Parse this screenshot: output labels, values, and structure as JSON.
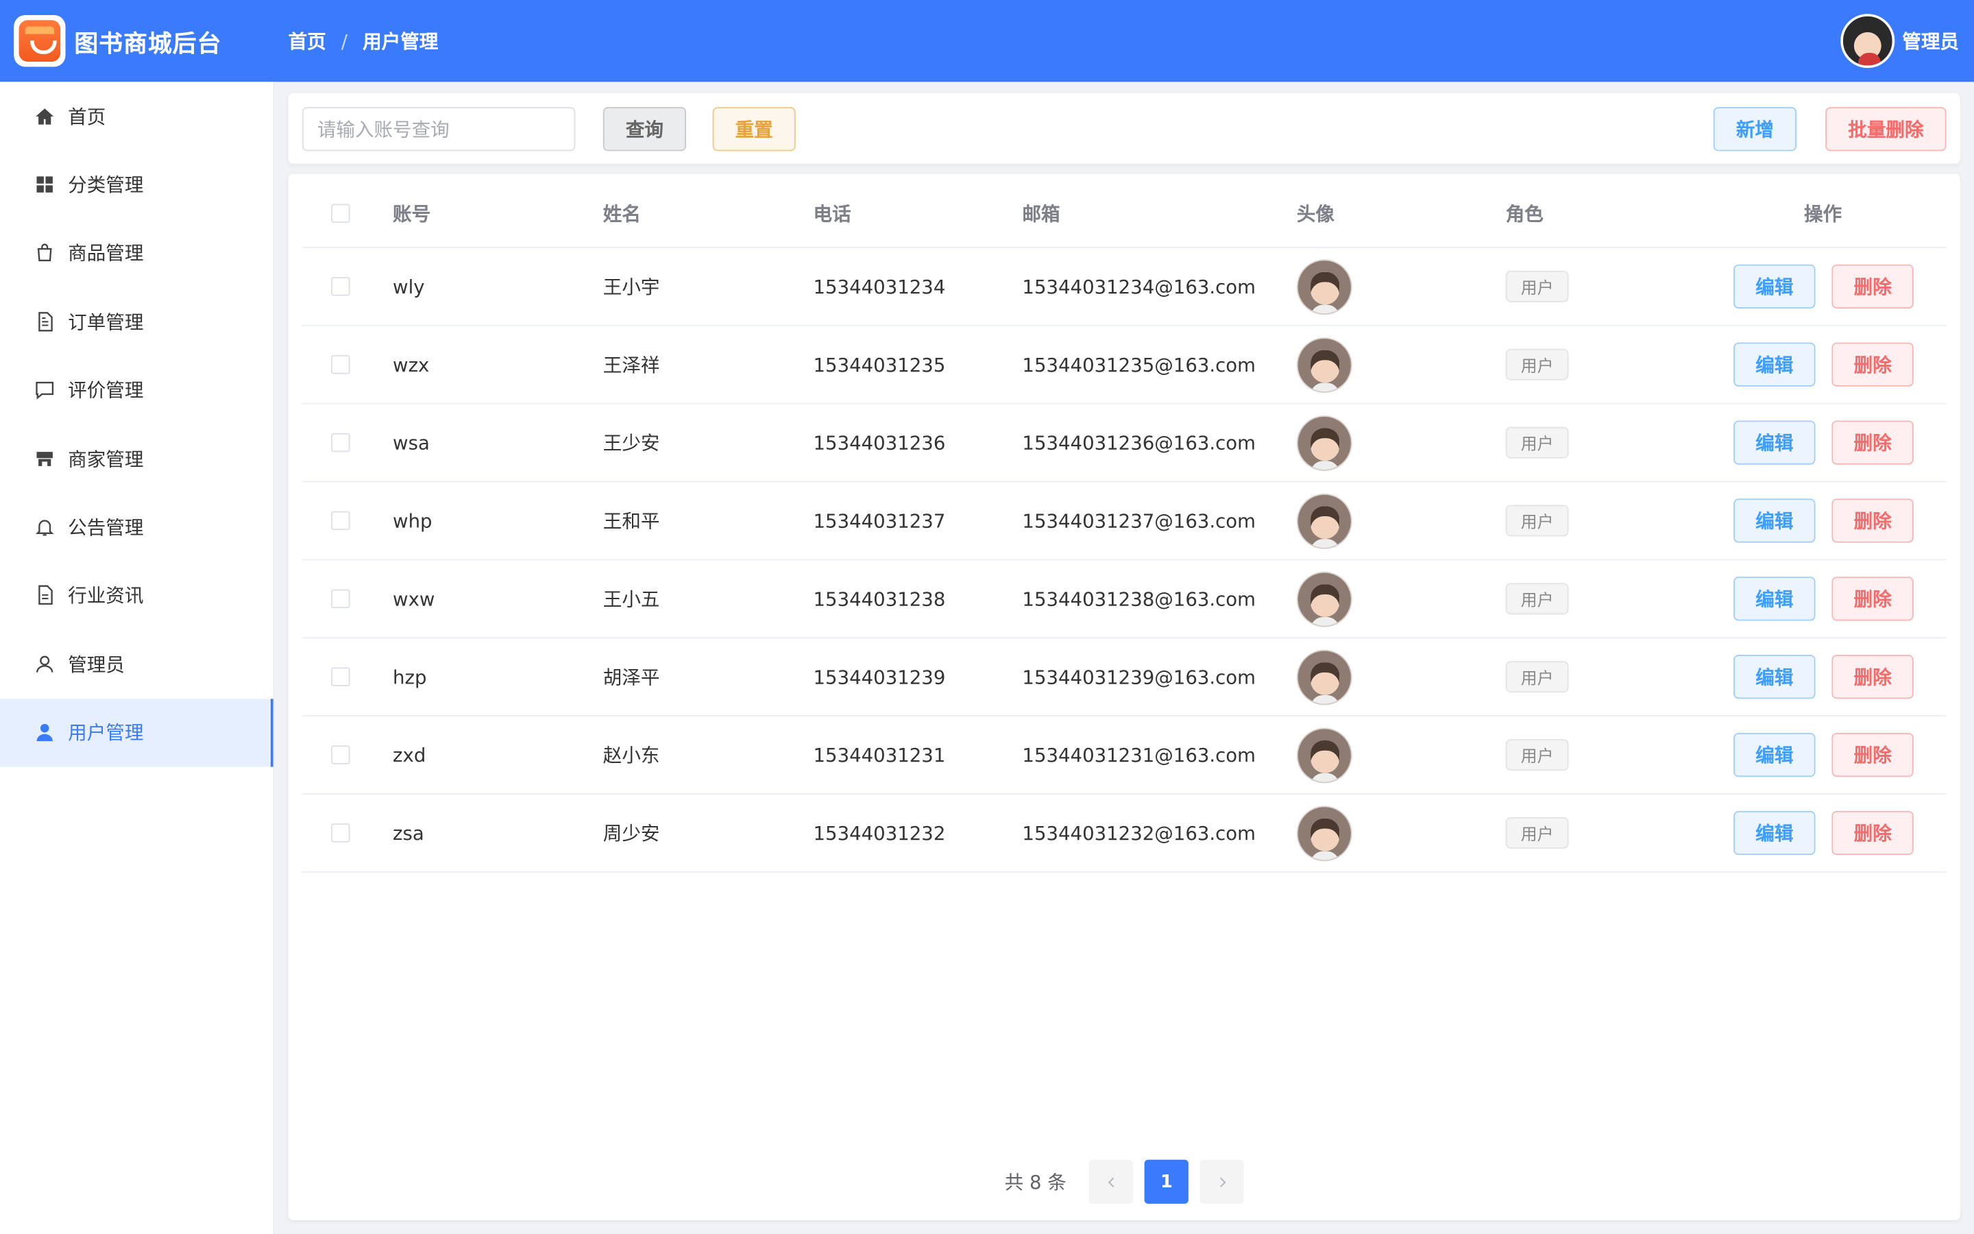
{
  "header": {
    "app_title": "图书商城后台",
    "breadcrumb": [
      "首页",
      "用户管理"
    ],
    "breadcrumb_sep": "/",
    "user_name": "管理员"
  },
  "sidebar": {
    "items": [
      {
        "label": "首页",
        "icon": "home-icon"
      },
      {
        "label": "分类管理",
        "icon": "grid-icon"
      },
      {
        "label": "商品管理",
        "icon": "bag-icon"
      },
      {
        "label": "订单管理",
        "icon": "document-icon"
      },
      {
        "label": "评价管理",
        "icon": "comment-icon"
      },
      {
        "label": "商家管理",
        "icon": "store-icon"
      },
      {
        "label": "公告管理",
        "icon": "bell-icon"
      },
      {
        "label": "行业资讯",
        "icon": "news-icon"
      },
      {
        "label": "管理员",
        "icon": "user-outline-icon"
      },
      {
        "label": "用户管理",
        "icon": "user-filled-icon",
        "active": true
      }
    ]
  },
  "toolbar": {
    "search_placeholder": "请输入账号查询",
    "search_value": "",
    "query_label": "查询",
    "reset_label": "重置",
    "add_label": "新增",
    "batch_delete_label": "批量删除"
  },
  "table": {
    "columns": [
      "账号",
      "姓名",
      "电话",
      "邮箱",
      "头像",
      "角色",
      "操作"
    ],
    "rows": [
      {
        "account": "wly",
        "name": "王小宇",
        "phone": "15344031234",
        "email": "15344031234@163.com",
        "role": "用户"
      },
      {
        "account": "wzx",
        "name": "王泽祥",
        "phone": "15344031235",
        "email": "15344031235@163.com",
        "role": "用户"
      },
      {
        "account": "wsa",
        "name": "王少安",
        "phone": "15344031236",
        "email": "15344031236@163.com",
        "role": "用户"
      },
      {
        "account": "whp",
        "name": "王和平",
        "phone": "15344031237",
        "email": "15344031237@163.com",
        "role": "用户"
      },
      {
        "account": "wxw",
        "name": "王小五",
        "phone": "15344031238",
        "email": "15344031238@163.com",
        "role": "用户"
      },
      {
        "account": "hzp",
        "name": "胡泽平",
        "phone": "15344031239",
        "email": "15344031239@163.com",
        "role": "用户"
      },
      {
        "account": "zxd",
        "name": "赵小东",
        "phone": "15344031231",
        "email": "15344031231@163.com",
        "role": "用户"
      },
      {
        "account": "zsa",
        "name": "周少安",
        "phone": "15344031232",
        "email": "15344031232@163.com",
        "role": "用户"
      }
    ],
    "edit_label": "编辑",
    "delete_label": "删除"
  },
  "pagination": {
    "total_text": "共 8 条",
    "current_page": "1",
    "prev_icon": "chevron-left-icon",
    "next_icon": "chevron-right-icon"
  },
  "colors": {
    "primary": "#3a7bfd",
    "warning": "#e6a23c",
    "danger": "#f56c6c",
    "info": "#409eff"
  }
}
